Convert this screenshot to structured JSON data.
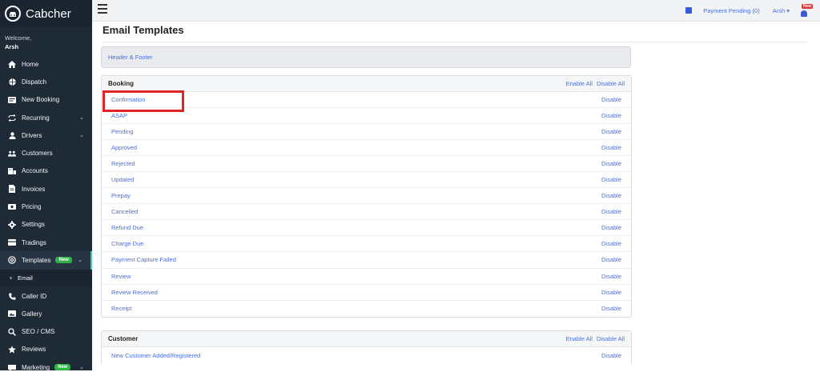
{
  "sidebar": {
    "brand": "Cabcher",
    "welcome": "Welcome,",
    "user": "Arsh",
    "items": [
      {
        "label": "Home",
        "icon": "home-icon"
      },
      {
        "label": "Dispatch",
        "icon": "globe-icon"
      },
      {
        "label": "New Booking",
        "icon": "booking-icon"
      },
      {
        "label": "Recurring",
        "icon": "repeat-icon"
      },
      {
        "label": "Drivers",
        "icon": "driver-icon"
      },
      {
        "label": "Customers",
        "icon": "users-icon"
      },
      {
        "label": "Accounts",
        "icon": "accounts-icon"
      },
      {
        "label": "Invoices",
        "icon": "invoice-icon"
      },
      {
        "label": "Pricing",
        "icon": "pricing-icon"
      },
      {
        "label": "Settings",
        "icon": "gear-icon"
      },
      {
        "label": "Tradings",
        "icon": "tradings-icon"
      },
      {
        "label": "Templates",
        "icon": "at-icon",
        "badge": "New"
      },
      {
        "label": "Email",
        "icon": "dot-icon"
      },
      {
        "label": "Caller ID",
        "icon": "phone-icon"
      },
      {
        "label": "Gallery",
        "icon": "gallery-icon"
      },
      {
        "label": "SEO / CMS",
        "icon": "seo-icon"
      },
      {
        "label": "Reviews",
        "icon": "star-icon"
      },
      {
        "label": "Marketing",
        "icon": "marketing-icon",
        "badge": "New"
      }
    ]
  },
  "topbar": {
    "payment_pending": "Payment Pending (0)",
    "user": "Arsh",
    "bell_badge": "New"
  },
  "page": {
    "title": "Email Templates",
    "header_footer": "Header & Footer"
  },
  "booking": {
    "title": "Booking",
    "enable_all": "Enable All",
    "disable_all": "Disable All",
    "rows": [
      {
        "name": "Confirmation",
        "action": "Disable"
      },
      {
        "name": "ASAP",
        "action": "Disable"
      },
      {
        "name": "Pending",
        "action": "Disable"
      },
      {
        "name": "Approved",
        "action": "Disable"
      },
      {
        "name": "Rejected",
        "action": "Disable"
      },
      {
        "name": "Updated",
        "action": "Disable"
      },
      {
        "name": "Prepay",
        "action": "Disable"
      },
      {
        "name": "Cancelled",
        "action": "Disable"
      },
      {
        "name": "Refund Due",
        "action": "Disable"
      },
      {
        "name": "Charge Due",
        "action": "Disable"
      },
      {
        "name": "Payment Capture Failed",
        "action": "Disable"
      },
      {
        "name": "Review",
        "action": "Disable"
      },
      {
        "name": "Review Received",
        "action": "Disable"
      },
      {
        "name": "Receipt",
        "action": "Disable"
      }
    ]
  },
  "customer": {
    "title": "Customer",
    "enable_all": "Enable All",
    "disable_all": "Disable All",
    "rows": [
      {
        "name": "New Customer Added/Registered",
        "action": "Disable"
      }
    ]
  },
  "colors": {
    "sidebar_bg": "#1f2a37",
    "link": "#4a6fdc",
    "badge_green": "#2fb344",
    "highlight_red": "#e02424"
  }
}
